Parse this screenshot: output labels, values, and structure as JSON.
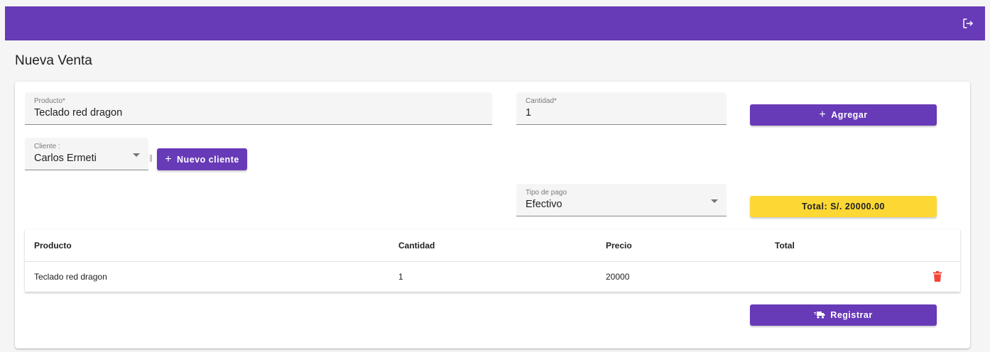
{
  "toolbar": {
    "logout_icon": "logout-icon",
    "color": "#673ab7"
  },
  "page": {
    "title": "Nueva Venta"
  },
  "form": {
    "producto": {
      "label": "Producto*",
      "value": "Teclado red dragon"
    },
    "cantidad": {
      "label": "Cantidad*",
      "value": "1"
    },
    "agregar_label": "Agregar",
    "cliente": {
      "label": "Cliente :",
      "value": "Carlos Ermeti"
    },
    "nuevo_cliente_label": "Nuevo cliente",
    "tipo_pago": {
      "label": "Tipo de pago",
      "value": "Efectivo"
    },
    "total_label": "Total: S/. 20000.00",
    "registrar_label": "Registrar"
  },
  "table": {
    "headers": [
      "Producto",
      "Cantidad",
      "Precio",
      "Total"
    ],
    "rows": [
      {
        "producto": "Teclado red dragon",
        "cantidad": "1",
        "precio": "20000",
        "total": ""
      }
    ]
  },
  "colors": {
    "primary": "#673ab7",
    "accent_total": "#fdd835",
    "delete": "#f44336"
  }
}
